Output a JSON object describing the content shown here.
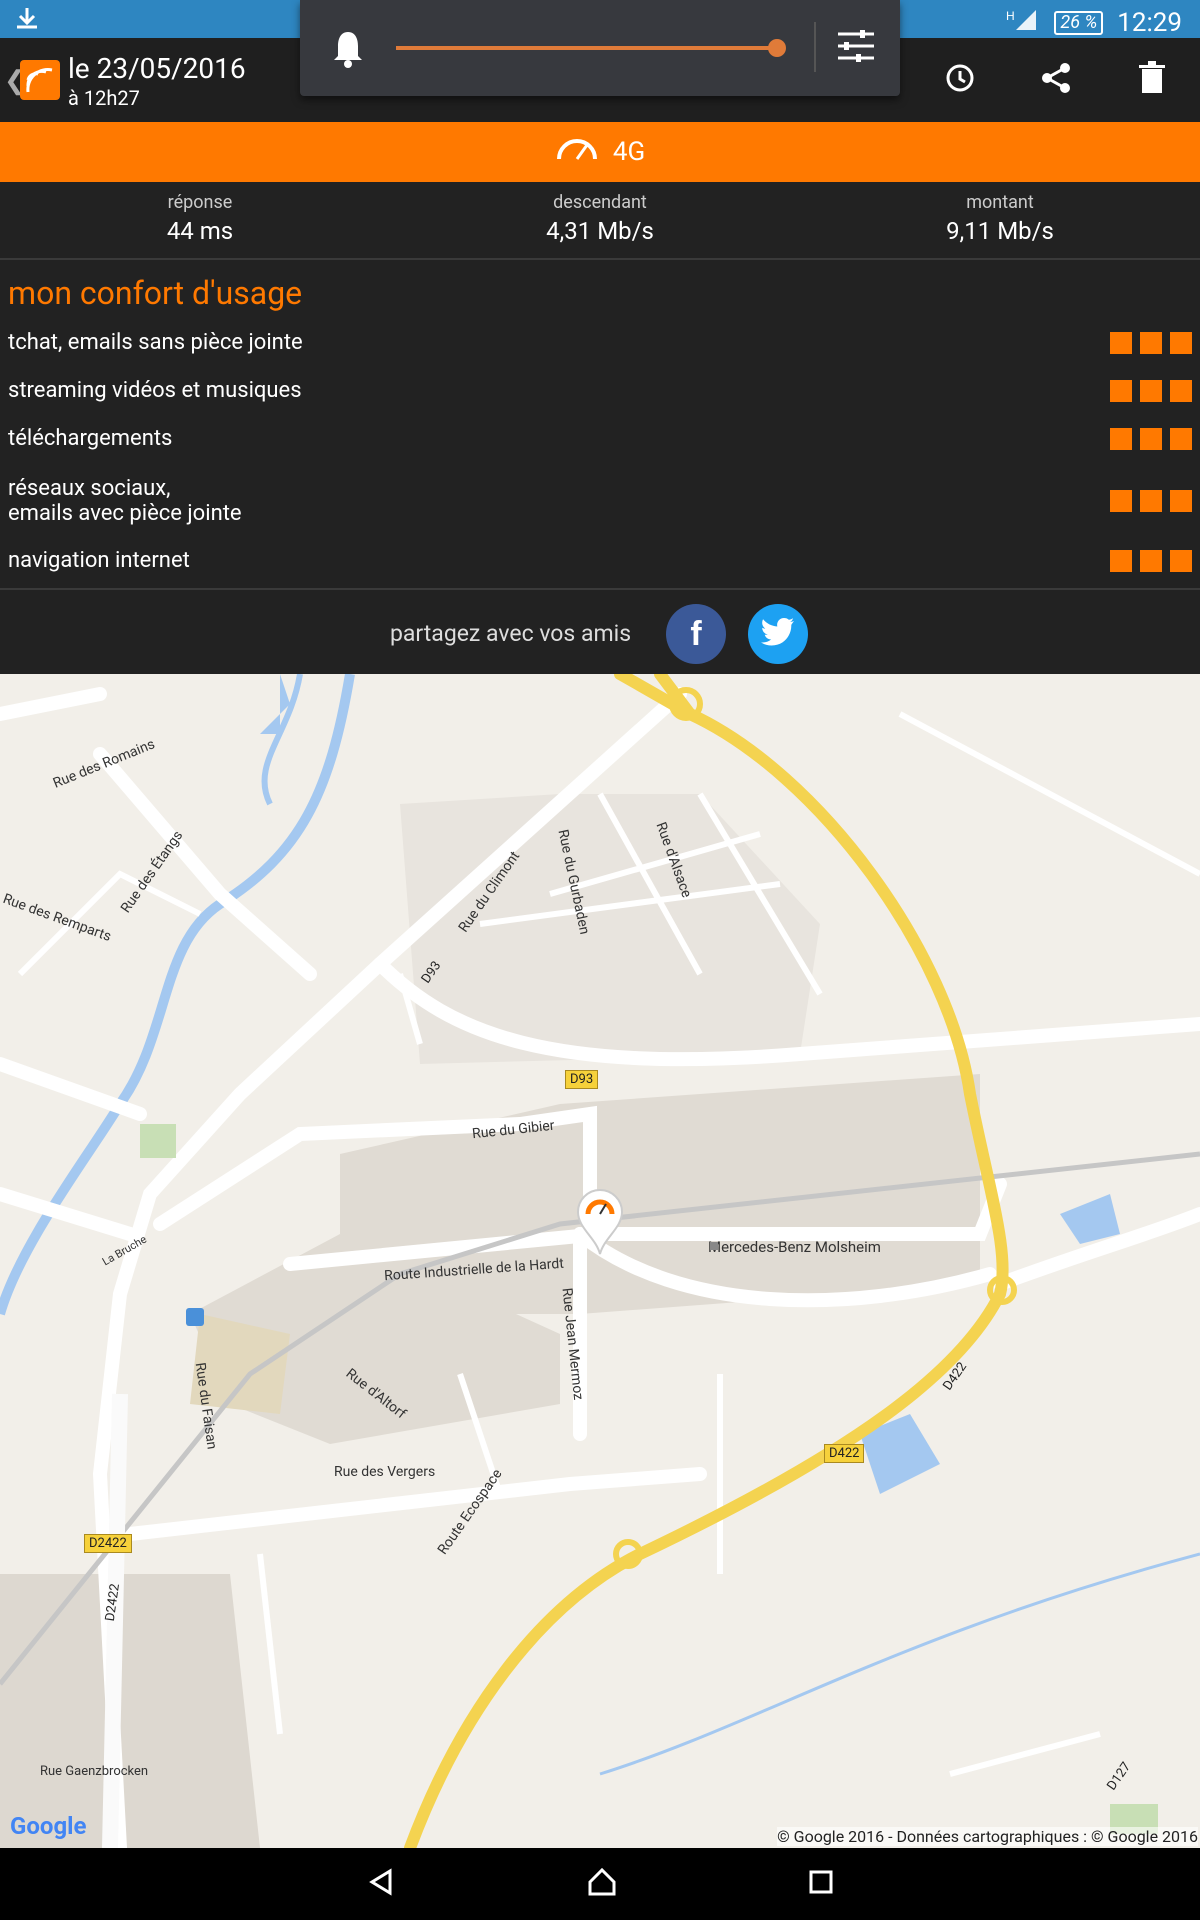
{
  "status": {
    "battery": "26 %",
    "clock": "12:29",
    "network": "H"
  },
  "header": {
    "date": "le 23/05/2016",
    "time": "à 12h27"
  },
  "banner": {
    "tech": "4G"
  },
  "stats": [
    {
      "label": "réponse",
      "value": "44 ms"
    },
    {
      "label": "descendant",
      "value": "4,31 Mb/s"
    },
    {
      "label": "montant",
      "value": "9,11 Mb/s"
    }
  ],
  "comfort": {
    "title": "mon confort d'usage",
    "items": [
      {
        "label": "tchat, emails sans pièce jointe",
        "level": 3
      },
      {
        "label": "streaming vidéos et musiques",
        "level": 3
      },
      {
        "label": "téléchargements",
        "level": 3
      },
      {
        "label_line1": "réseaux sociaux,",
        "label_line2": "emails avec pièce jointe",
        "level": 3
      },
      {
        "label": "navigation internet",
        "level": 3
      }
    ]
  },
  "share": {
    "text": "partagez avec vos amis",
    "facebook": "f"
  },
  "map": {
    "labels": {
      "romains": "Rue des Romains",
      "remparts": "Rue des Remparts",
      "etangs": "Rue des Étangs",
      "climont": "Rue du Climont",
      "gurbaden": "Rue du Gurbaden",
      "alsace": "Rue d'Alsace",
      "gibier": "Rue du Gibier",
      "hardt": "Route Industrielle de la Hardt",
      "mermoz": "Rue Jean Mermoz",
      "mercedes": "Mercedes-Benz Molsheim",
      "faisan": "Rue du Faisan",
      "altorf": "Rue d'Altorf",
      "vergers": "Rue des Vergers",
      "ecospace": "Route Ecospace",
      "bruche": "La Bruche",
      "gaenzbrocken": "Rue Gaenzbrocken"
    },
    "shields": {
      "d93_a": "D93",
      "d93_b": "D93",
      "d422_a": "D422",
      "d422_b": "D422",
      "d2422_a": "D2422",
      "d2422_b": "D2422",
      "d127": "D127"
    },
    "google": "Google",
    "copyright": "© Google 2016 - Données cartographiques : © Google 2016"
  }
}
